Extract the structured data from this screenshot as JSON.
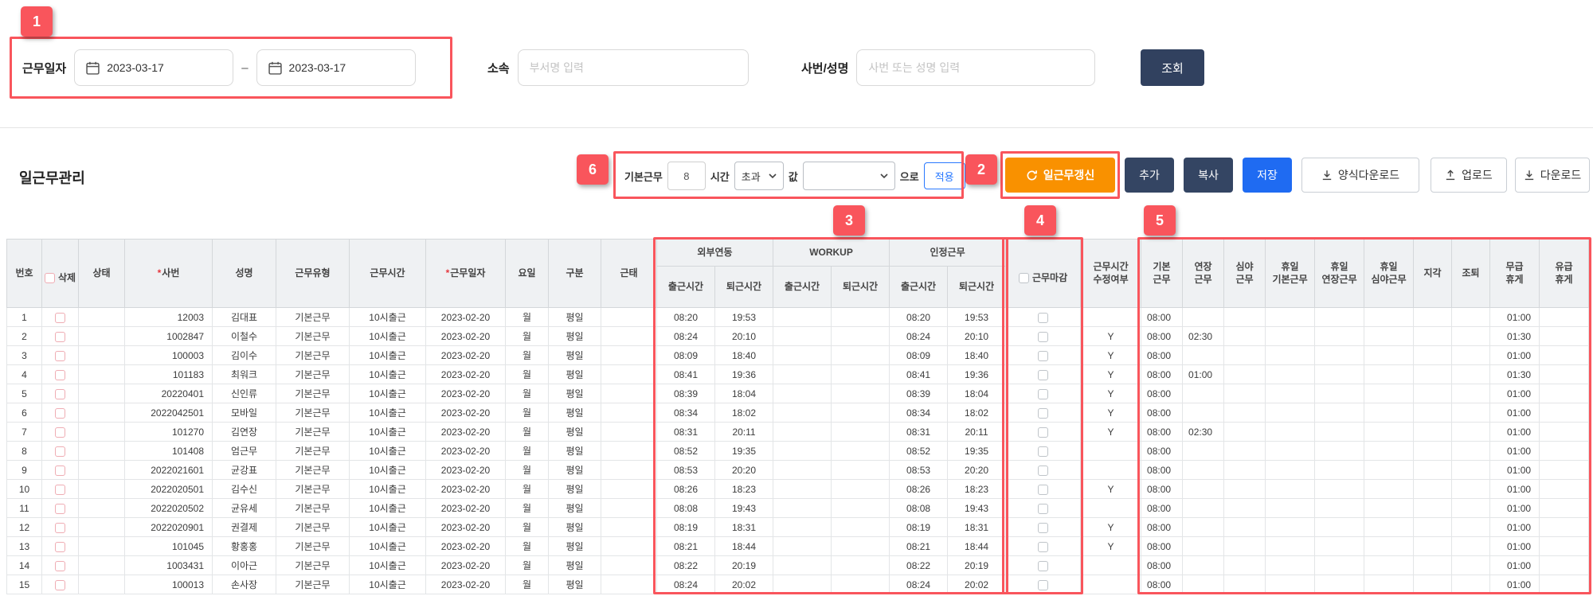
{
  "annotations": {
    "badges": [
      "1",
      "2",
      "3",
      "4",
      "5",
      "6"
    ]
  },
  "filter": {
    "work_date_label": "근무일자",
    "date_from": "2023-03-17",
    "date_range_separator": "–",
    "date_to": "2023-03-17",
    "department_label": "소속",
    "department_placeholder": "부서명 입력",
    "employee_label": "사번/성명",
    "employee_placeholder": "사번 또는 성명 입력",
    "search_button": "조회"
  },
  "toolbar": {
    "page_title": "일근무관리",
    "basic_work_label": "기본근무",
    "basic_hours_value": "8",
    "hours_label": "시간",
    "mode_select_value": "초과",
    "value_label": "값",
    "value_select_value": "",
    "suffix_label": "으로",
    "apply_button": "적용",
    "refresh_button": "일근무갱신",
    "add_button": "추가",
    "copy_button": "복사",
    "save_button": "저장",
    "template_download_button": "양식다운로드",
    "upload_button": "업로드",
    "download_button": "다운로드"
  },
  "table": {
    "required_marker": "*",
    "headers": {
      "no": "번호",
      "del": "삭제",
      "status": "상태",
      "empno": "사번",
      "name": "성명",
      "worktype": "근무유형",
      "worktime": "근무시간",
      "workdate": "근무일자",
      "day": "요일",
      "category": "구분",
      "attendance": "근태",
      "group_external": "외부연동",
      "group_workup": "WORKUP",
      "group_recognized": "인정근무",
      "clock_in": "출근시간",
      "clock_out": "퇴근시간",
      "close": "근무마감",
      "modified": "근무시간\n수정여부",
      "basic": "기본\n근무",
      "overtime": "연장\n근무",
      "night": "심야\n근무",
      "holiday_basic": "휴일\n기본근무",
      "holiday_overtime": "휴일\n연장근무",
      "holiday_night": "휴일\n심야근무",
      "late": "지각",
      "early_leave": "조퇴",
      "unpaid_break": "무급\n휴게",
      "paid_break": "유급\n휴게"
    },
    "columns": [
      {
        "key": "no",
        "align": "center"
      },
      {
        "key": "del",
        "type": "checkbox",
        "cls": "cb-del"
      },
      {
        "key": "status",
        "align": "center"
      },
      {
        "key": "empno",
        "align": "right"
      },
      {
        "key": "name",
        "align": "center"
      },
      {
        "key": "worktype",
        "align": "center"
      },
      {
        "key": "worktime",
        "align": "center"
      },
      {
        "key": "workdate",
        "align": "center"
      },
      {
        "key": "day",
        "align": "center"
      },
      {
        "key": "category",
        "align": "center"
      },
      {
        "key": "attendance",
        "align": "center"
      },
      {
        "key": "ext_in",
        "align": "center"
      },
      {
        "key": "ext_out",
        "align": "center"
      },
      {
        "key": "wu_in",
        "align": "center"
      },
      {
        "key": "wu_out",
        "align": "center"
      },
      {
        "key": "rec_in",
        "align": "center"
      },
      {
        "key": "rec_out",
        "align": "center"
      },
      {
        "key": "close",
        "type": "checkbox",
        "cls": "cb-gray"
      },
      {
        "key": "modified",
        "align": "center"
      },
      {
        "key": "basic",
        "align": "left"
      },
      {
        "key": "overtime",
        "align": "left"
      },
      {
        "key": "night",
        "align": "left"
      },
      {
        "key": "hol_basic",
        "align": "left"
      },
      {
        "key": "hol_over",
        "align": "left"
      },
      {
        "key": "hol_night",
        "align": "left"
      },
      {
        "key": "late",
        "align": "left"
      },
      {
        "key": "early",
        "align": "left"
      },
      {
        "key": "unpaid",
        "align": "right"
      },
      {
        "key": "paid",
        "align": "right"
      }
    ],
    "rows": [
      {
        "no": "1",
        "empno": "12003",
        "name": "김대표",
        "worktype": "기본근무",
        "worktime": "10시출근",
        "workdate": "2023-02-20",
        "day": "월",
        "category": "평일",
        "ext_in": "08:20",
        "ext_out": "19:53",
        "rec_in": "08:20",
        "rec_out": "19:53",
        "basic": "08:00",
        "unpaid": "01:00"
      },
      {
        "no": "2",
        "empno": "1002847",
        "name": "이철수",
        "worktype": "기본근무",
        "worktime": "10시출근",
        "workdate": "2023-02-20",
        "day": "월",
        "category": "평일",
        "ext_in": "08:24",
        "ext_out": "20:10",
        "rec_in": "08:24",
        "rec_out": "20:10",
        "modified": "Y",
        "basic": "08:00",
        "overtime": "02:30",
        "unpaid": "01:30"
      },
      {
        "no": "3",
        "empno": "100003",
        "name": "김이수",
        "worktype": "기본근무",
        "worktime": "10시출근",
        "workdate": "2023-02-20",
        "day": "월",
        "category": "평일",
        "ext_in": "08:09",
        "ext_out": "18:40",
        "rec_in": "08:09",
        "rec_out": "18:40",
        "modified": "Y",
        "basic": "08:00",
        "unpaid": "01:00"
      },
      {
        "no": "4",
        "empno": "101183",
        "name": "최워크",
        "worktype": "기본근무",
        "worktime": "10시출근",
        "workdate": "2023-02-20",
        "day": "월",
        "category": "평일",
        "ext_in": "08:41",
        "ext_out": "19:36",
        "rec_in": "08:41",
        "rec_out": "19:36",
        "modified": "Y",
        "basic": "08:00",
        "overtime": "01:00",
        "unpaid": "01:30"
      },
      {
        "no": "5",
        "empno": "20220401",
        "name": "신인류",
        "worktype": "기본근무",
        "worktime": "10시출근",
        "workdate": "2023-02-20",
        "day": "월",
        "category": "평일",
        "ext_in": "08:39",
        "ext_out": "18:04",
        "rec_in": "08:39",
        "rec_out": "18:04",
        "modified": "Y",
        "basic": "08:00",
        "unpaid": "01:00"
      },
      {
        "no": "6",
        "empno": "2022042501",
        "name": "모바일",
        "worktype": "기본근무",
        "worktime": "10시출근",
        "workdate": "2023-02-20",
        "day": "월",
        "category": "평일",
        "ext_in": "08:34",
        "ext_out": "18:02",
        "rec_in": "08:34",
        "rec_out": "18:02",
        "modified": "Y",
        "basic": "08:00",
        "unpaid": "01:00"
      },
      {
        "no": "7",
        "empno": "101270",
        "name": "김연장",
        "worktype": "기본근무",
        "worktime": "10시출근",
        "workdate": "2023-02-20",
        "day": "월",
        "category": "평일",
        "ext_in": "08:31",
        "ext_out": "20:11",
        "rec_in": "08:31",
        "rec_out": "20:11",
        "modified": "Y",
        "basic": "08:00",
        "overtime": "02:30",
        "unpaid": "01:00"
      },
      {
        "no": "8",
        "empno": "101408",
        "name": "엄근무",
        "worktype": "기본근무",
        "worktime": "10시출근",
        "workdate": "2023-02-20",
        "day": "월",
        "category": "평일",
        "ext_in": "08:52",
        "ext_out": "19:35",
        "rec_in": "08:52",
        "rec_out": "19:35",
        "basic": "08:00",
        "unpaid": "01:00"
      },
      {
        "no": "9",
        "empno": "2022021601",
        "name": "균강표",
        "worktype": "기본근무",
        "worktime": "10시출근",
        "workdate": "2023-02-20",
        "day": "월",
        "category": "평일",
        "ext_in": "08:53",
        "ext_out": "20:20",
        "rec_in": "08:53",
        "rec_out": "20:20",
        "basic": "08:00",
        "unpaid": "01:00"
      },
      {
        "no": "10",
        "empno": "2022020501",
        "name": "김수신",
        "worktype": "기본근무",
        "worktime": "10시출근",
        "workdate": "2023-02-20",
        "day": "월",
        "category": "평일",
        "ext_in": "08:26",
        "ext_out": "18:23",
        "rec_in": "08:26",
        "rec_out": "18:23",
        "modified": "Y",
        "basic": "08:00",
        "unpaid": "01:00"
      },
      {
        "no": "11",
        "empno": "2022020502",
        "name": "균유세",
        "worktype": "기본근무",
        "worktime": "10시출근",
        "workdate": "2023-02-20",
        "day": "월",
        "category": "평일",
        "ext_in": "08:08",
        "ext_out": "19:43",
        "rec_in": "08:08",
        "rec_out": "19:43",
        "basic": "08:00",
        "unpaid": "01:00"
      },
      {
        "no": "12",
        "empno": "2022020901",
        "name": "권결제",
        "worktype": "기본근무",
        "worktime": "10시출근",
        "workdate": "2023-02-20",
        "day": "월",
        "category": "평일",
        "ext_in": "08:19",
        "ext_out": "18:31",
        "rec_in": "08:19",
        "rec_out": "18:31",
        "modified": "Y",
        "basic": "08:00",
        "unpaid": "01:00"
      },
      {
        "no": "13",
        "empno": "101045",
        "name": "황홍홍",
        "worktype": "기본근무",
        "worktime": "10시출근",
        "workdate": "2023-02-20",
        "day": "월",
        "category": "평일",
        "ext_in": "08:21",
        "ext_out": "18:44",
        "rec_in": "08:21",
        "rec_out": "18:44",
        "modified": "Y",
        "basic": "08:00",
        "unpaid": "01:00"
      },
      {
        "no": "14",
        "empno": "1003431",
        "name": "이아근",
        "worktype": "기본근무",
        "worktime": "10시출근",
        "workdate": "2023-02-20",
        "day": "월",
        "category": "평일",
        "ext_in": "08:22",
        "ext_out": "20:19",
        "rec_in": "08:22",
        "rec_out": "20:19",
        "basic": "08:00",
        "unpaid": "01:00"
      },
      {
        "no": "15",
        "empno": "100013",
        "name": "손사장",
        "worktype": "기본근무",
        "worktime": "10시출근",
        "workdate": "2023-02-20",
        "day": "월",
        "category": "평일",
        "ext_in": "08:24",
        "ext_out": "20:02",
        "rec_in": "08:24",
        "rec_out": "20:02",
        "basic": "08:00",
        "unpaid": "01:00"
      }
    ]
  }
}
